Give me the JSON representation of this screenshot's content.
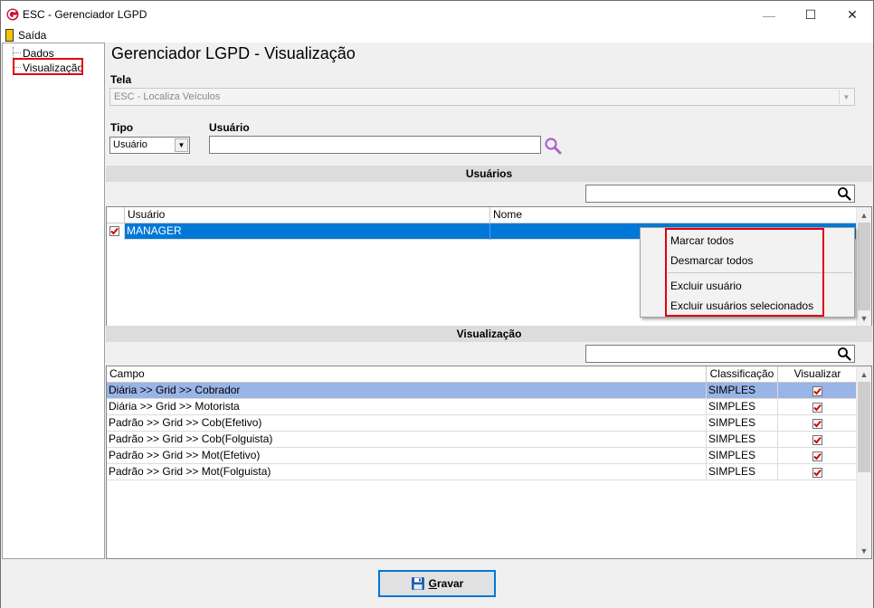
{
  "window": {
    "title": "ESC - Gerenciador LGPD",
    "minimize": "—",
    "maximize": "☐",
    "close": "✕"
  },
  "menu": {
    "exit": "Saída"
  },
  "tree": {
    "items": [
      "Dados",
      "Visualização"
    ],
    "selected": "Visualização"
  },
  "page_title": "Gerenciador LGPD - Visualização",
  "tela": {
    "label": "Tela",
    "value": "ESC - Localiza Veículos"
  },
  "tipo": {
    "label": "Tipo",
    "value": "Usuário"
  },
  "usuario": {
    "label": "Usuário",
    "value": ""
  },
  "usuarios_section": {
    "title": "Usuários",
    "search_value": "",
    "columns": [
      "Usuário",
      "Nome"
    ],
    "rows": [
      {
        "checked": true,
        "usuario": "MANAGER",
        "nome": ""
      }
    ]
  },
  "context_menu": {
    "items": [
      "Marcar todos",
      "Desmarcar todos",
      "Excluir usuário",
      "Excluir usuários selecionados"
    ]
  },
  "visualizacao_section": {
    "title": "Visualização",
    "search_value": "",
    "columns": [
      "Campo",
      "Classificação",
      "Visualizar"
    ],
    "rows": [
      {
        "campo": "Diária >> Grid >> Cobrador",
        "classificacao": "SIMPLES",
        "visualizar": true
      },
      {
        "campo": "Diária >> Grid >> Motorista",
        "classificacao": "SIMPLES",
        "visualizar": true
      },
      {
        "campo": "Padrão >> Grid >> Cob(Efetivo)",
        "classificacao": "SIMPLES",
        "visualizar": true
      },
      {
        "campo": "Padrão >> Grid >> Cob(Folguista)",
        "classificacao": "SIMPLES",
        "visualizar": true
      },
      {
        "campo": "Padrão >> Grid >> Mot(Efetivo)",
        "classificacao": "SIMPLES",
        "visualizar": true
      },
      {
        "campo": "Padrão >> Grid >> Mot(Folguista)",
        "classificacao": "SIMPLES",
        "visualizar": true
      }
    ]
  },
  "buttons": {
    "gravar_first": "G",
    "gravar_rest": "ravar"
  },
  "colors": {
    "selection_blue": "#0078d7",
    "row_highlight": "#99b4e6",
    "highlight_red": "#e0000e",
    "check_red": "#d40000",
    "search_icon_purple": "#b060d0"
  },
  "icons": {
    "app": "app-logo-icon",
    "exit": "exit-door-icon",
    "search": "magnifier-icon",
    "save": "floppy-disk-icon"
  }
}
